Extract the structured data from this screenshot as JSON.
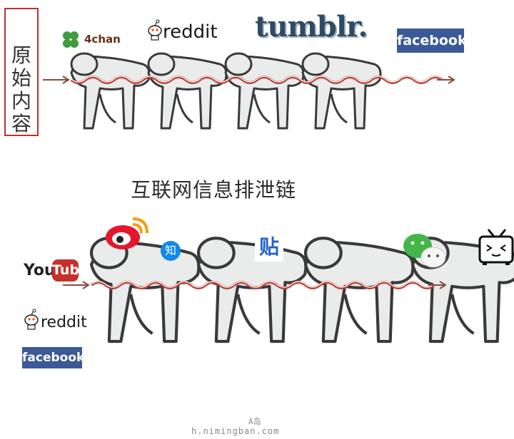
{
  "label_box": {
    "chars": [
      "原",
      "始",
      "内",
      "容"
    ]
  },
  "chain_title": "互联网信息排泄链",
  "logos": {
    "fourchan": "4chan",
    "reddit_top": "reddit",
    "tumblr": "tumblr.",
    "facebook_top": "facebook",
    "youtube_you": "You",
    "youtube_tube": "Tube",
    "reddit_bottom": "reddit",
    "facebook_bottom": "facebook",
    "zhihu": "知",
    "tieba": "贴"
  },
  "watermark": {
    "line1": "A岛",
    "line2": "h.nimingban.com"
  },
  "colors": {
    "figure_fill": "#e9ecea",
    "outline": "#3a3a3a",
    "intestine": "#b9413a",
    "arrow": "#8b4a3c",
    "facebook_blue": "#3b5998",
    "youtube_red": "#c4302b",
    "tumblr_navy": "#2f4a63",
    "weibo_red": "#e6162d",
    "wechat_green": "#44b549",
    "zhihu_blue": "#0f88eb",
    "fourchan_green": "#3f9b3d"
  }
}
